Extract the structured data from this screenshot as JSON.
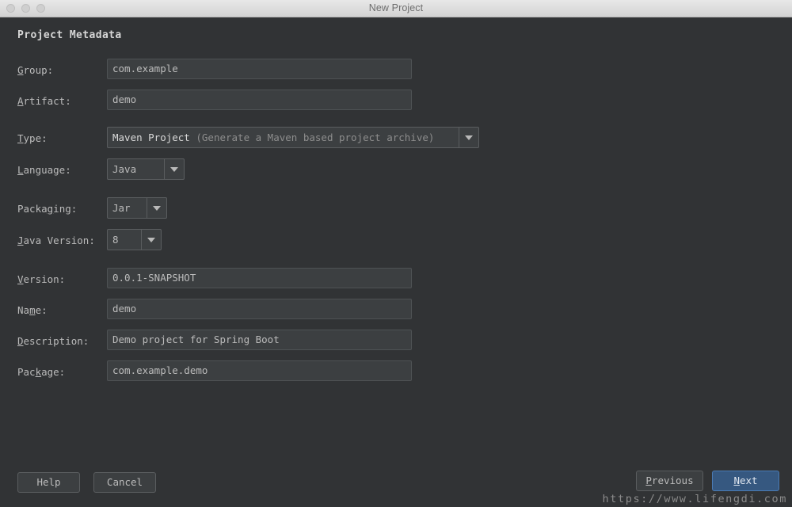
{
  "window": {
    "title": "New Project",
    "controls": [
      "close-button",
      "minimize-button",
      "zoom-button"
    ]
  },
  "panel": {
    "section_title": "Project Metadata"
  },
  "form": {
    "group": {
      "label_pre": "",
      "label_mnemonic": "G",
      "label_post": "roup:",
      "value": "com.example",
      "type": "text"
    },
    "artifact": {
      "label_pre": "",
      "label_mnemonic": "A",
      "label_post": "rtifact:",
      "value": "demo",
      "type": "text"
    },
    "type": {
      "label_pre": "",
      "label_mnemonic": "T",
      "label_post": "ype:",
      "value_strong": "Maven Project",
      "value_dim": "(Generate a Maven based project archive)",
      "type": "combo"
    },
    "language": {
      "label_pre": "",
      "label_mnemonic": "L",
      "label_post": "anguage:",
      "value": "Java",
      "type": "combo"
    },
    "packaging": {
      "label_pre": "Packa",
      "label_mnemonic": "g",
      "label_post": "ing:",
      "value": "Jar",
      "type": "combo"
    },
    "java_version": {
      "label_pre": "",
      "label_mnemonic": "J",
      "label_post": "ava Version:",
      "value": "8",
      "type": "combo"
    },
    "version": {
      "label_pre": "",
      "label_mnemonic": "V",
      "label_post": "ersion:",
      "value": "0.0.1-SNAPSHOT",
      "type": "text"
    },
    "name": {
      "label_pre": "Na",
      "label_mnemonic": "m",
      "label_post": "e:",
      "value": "demo",
      "type": "text"
    },
    "description": {
      "label_pre": "",
      "label_mnemonic": "D",
      "label_post": "escription:",
      "value": "Demo project for Spring Boot",
      "type": "text"
    },
    "package": {
      "label_pre": "Pac",
      "label_mnemonic": "k",
      "label_post": "age:",
      "value": "com.example.demo",
      "type": "text"
    }
  },
  "buttons": {
    "help": {
      "label": "Help"
    },
    "cancel": {
      "label": "Cancel"
    },
    "previous": {
      "pre": "",
      "mnemonic": "P",
      "post": "revious"
    },
    "next": {
      "pre": "",
      "mnemonic": "N",
      "post": "ext"
    }
  },
  "watermark": {
    "text": "https://www.lifengdi.com"
  },
  "colors": {
    "window_background": "#313335",
    "field_background": "#3c3f41",
    "field_border": "#5a5d5f",
    "text": "#bbbbbb",
    "primary_button": "#365880",
    "primary_button_border": "#4a7bb5",
    "titlebar": "#dcdcdc"
  }
}
